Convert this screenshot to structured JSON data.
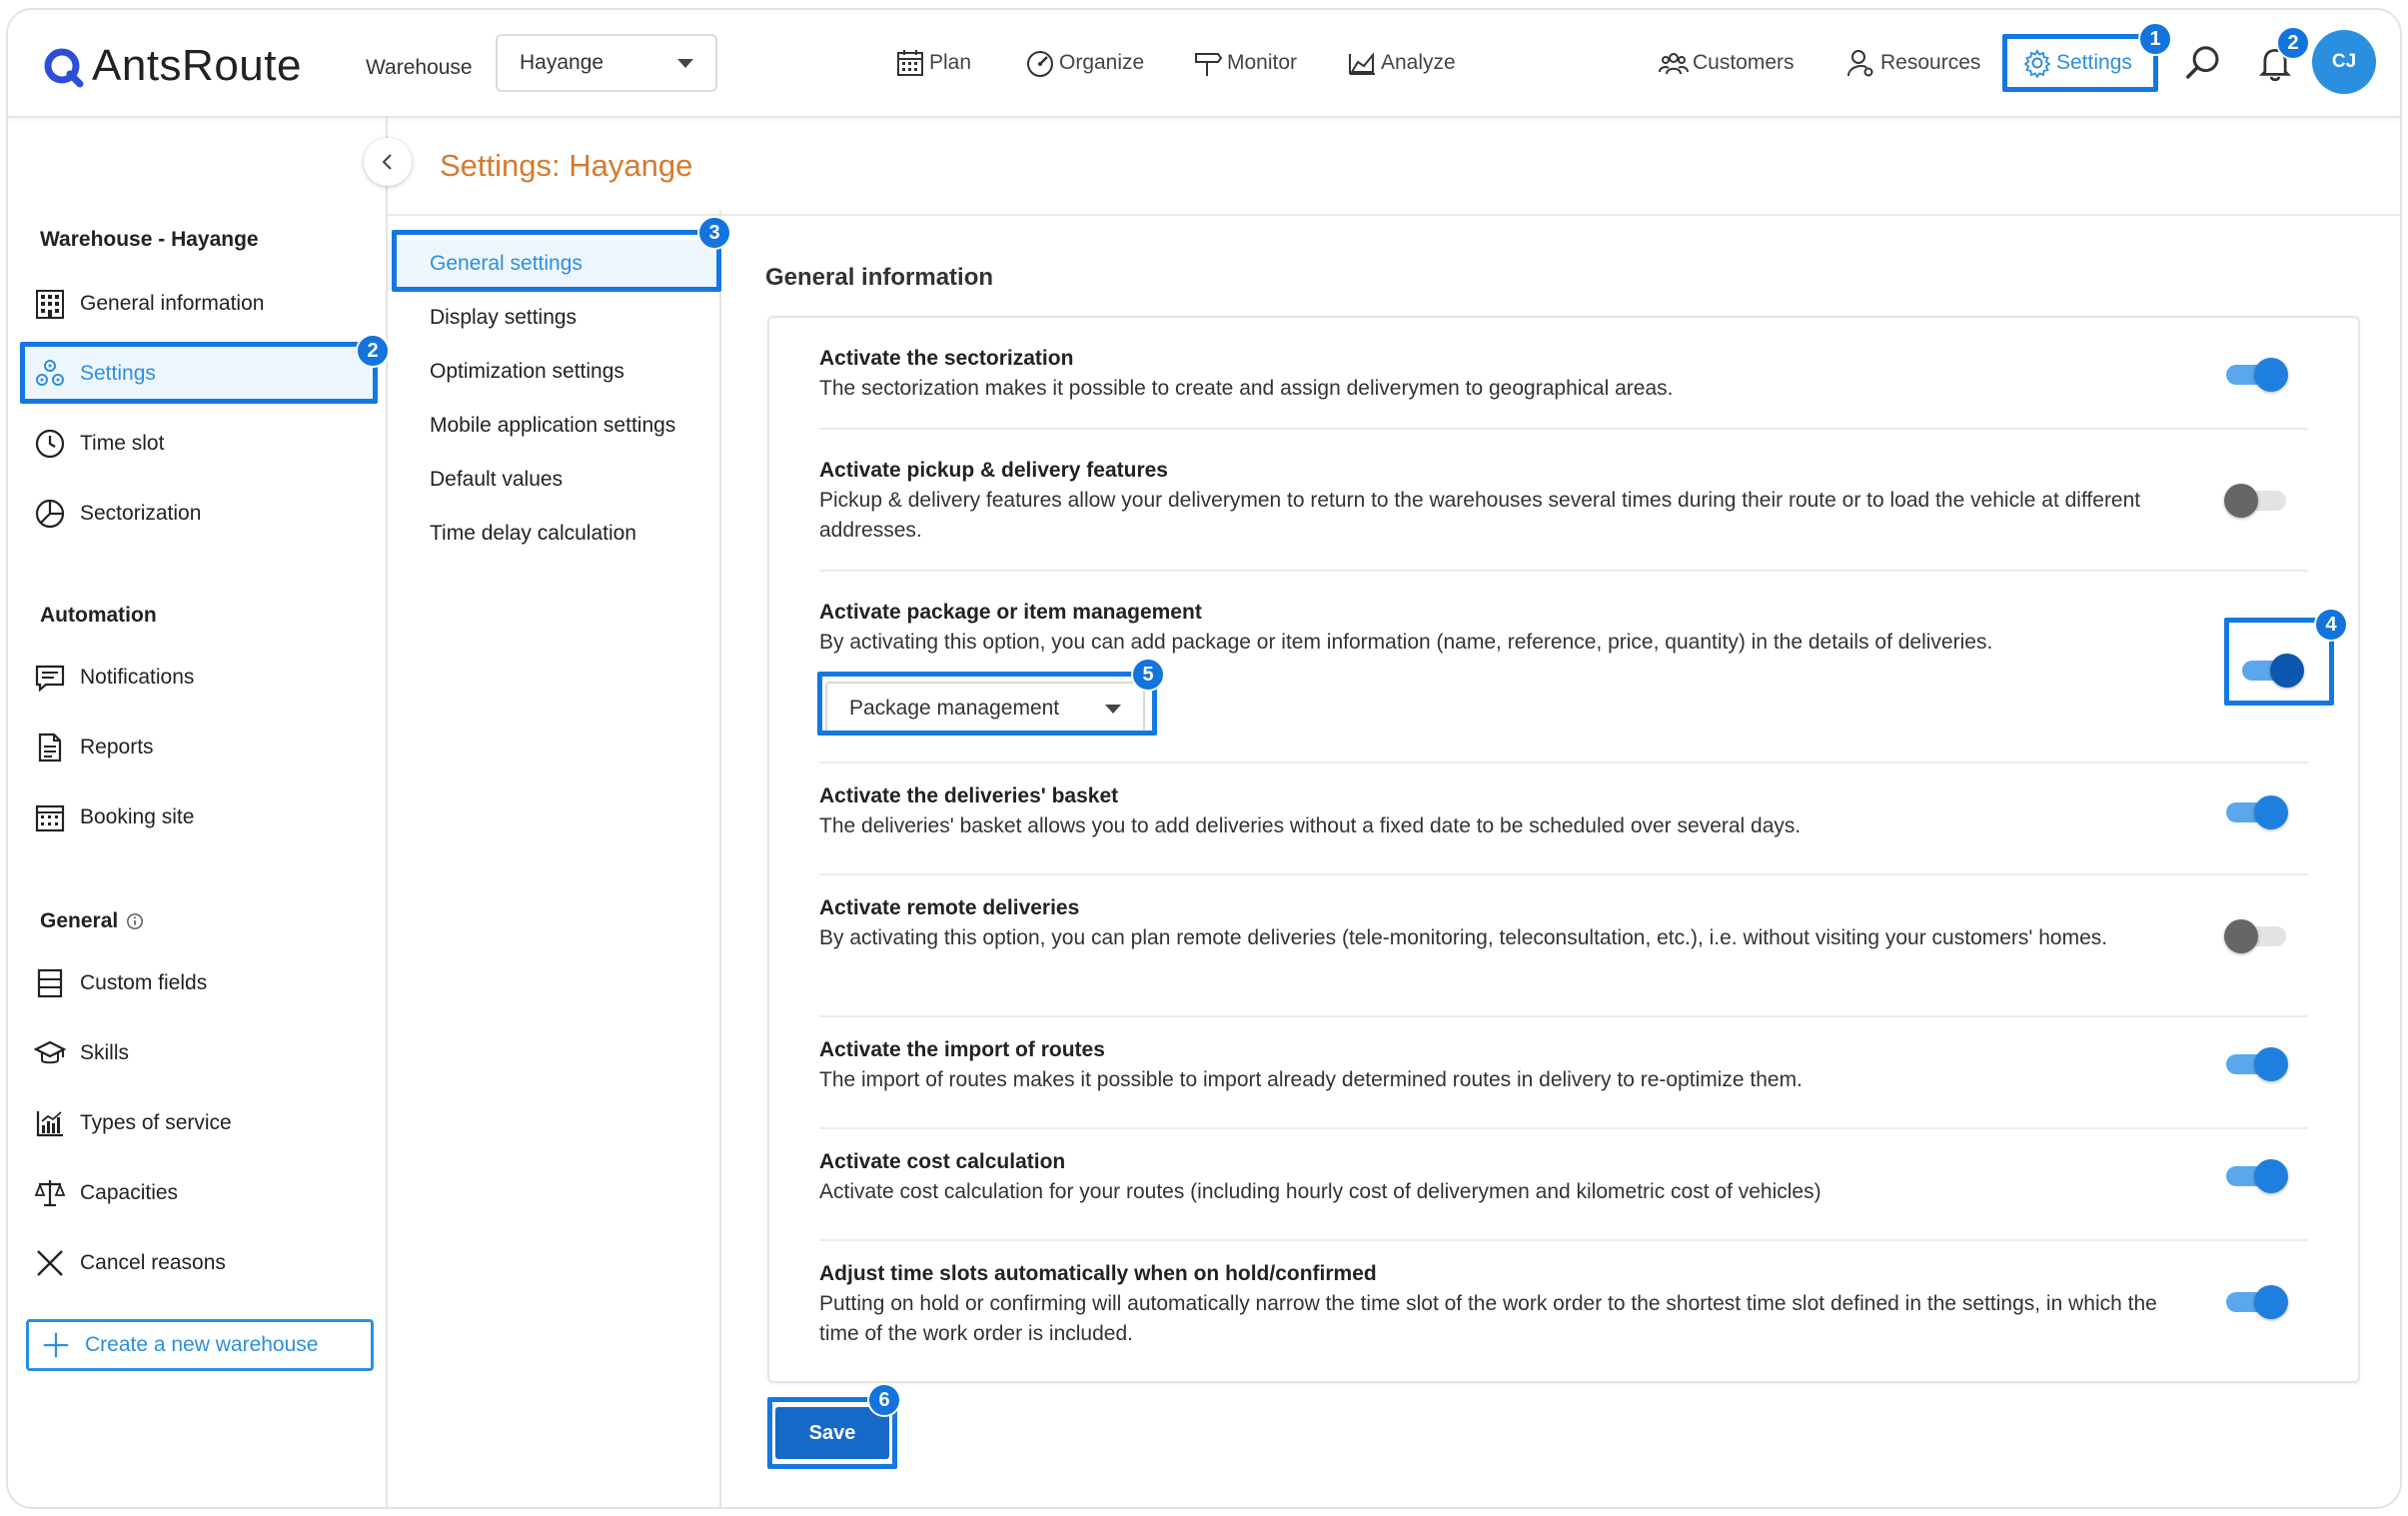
{
  "header": {
    "logo_text": "AntsRoute",
    "warehouse_label": "Warehouse",
    "warehouse_value": "Hayange",
    "nav": {
      "plan": "Plan",
      "organize": "Organize",
      "monitor": "Monitor",
      "analyze": "Analyze",
      "customers": "Customers",
      "resources": "Resources",
      "settings": "Settings"
    },
    "notification_count": "2",
    "avatar_initials": "CJ"
  },
  "page": {
    "title": "Settings: Hayange"
  },
  "sidebar": {
    "warehouse_heading": "Warehouse - Hayange",
    "warehouse_items": [
      {
        "label": "General information",
        "icon": "building-icon"
      },
      {
        "label": "Settings",
        "icon": "cogs-icon"
      },
      {
        "label": "Time slot",
        "icon": "clock-icon"
      },
      {
        "label": "Sectorization",
        "icon": "pie-icon"
      }
    ],
    "automation_heading": "Automation",
    "automation_items": [
      {
        "label": "Notifications",
        "icon": "message-icon"
      },
      {
        "label": "Reports",
        "icon": "document-icon"
      },
      {
        "label": "Booking site",
        "icon": "calendar-icon"
      }
    ],
    "general_heading": "General",
    "general_items": [
      {
        "label": "Custom fields",
        "icon": "list-icon"
      },
      {
        "label": "Skills",
        "icon": "graduation-cap-icon"
      },
      {
        "label": "Types of service",
        "icon": "chart-icon"
      },
      {
        "label": "Capacities",
        "icon": "scale-icon"
      },
      {
        "label": "Cancel reasons",
        "icon": "x-icon"
      }
    ],
    "create_button": "Create a new warehouse"
  },
  "subnav": {
    "items": [
      "General settings",
      "Display settings",
      "Optimization settings",
      "Mobile application settings",
      "Default values",
      "Time delay calculation"
    ]
  },
  "main": {
    "section_title": "General information",
    "settings": [
      {
        "title": "Activate the sectorization",
        "desc": "The sectorization makes it possible to create and assign deliverymen to geographical areas.",
        "enabled": true
      },
      {
        "title": "Activate pickup & delivery features",
        "desc": "Pickup & delivery features allow your deliverymen to return to the warehouses several times during their route or to load the vehicle at different addresses.",
        "enabled": false
      },
      {
        "title": "Activate package or item management",
        "desc": "By activating this option, you can add package or item information (name, reference, price, quantity) in the details of deliveries.",
        "enabled": true,
        "select_value": "Package management"
      },
      {
        "title": "Activate the deliveries' basket",
        "desc": "The deliveries' basket allows you to add deliveries without a fixed date to be scheduled over several days.",
        "enabled": true
      },
      {
        "title": "Activate remote deliveries",
        "desc": "By activating this option, you can plan remote deliveries (tele-monitoring, teleconsultation, etc.), i.e. without visiting your customers' homes.",
        "enabled": false
      },
      {
        "title": "Activate the import of routes",
        "desc": "The import of routes makes it possible to import already determined routes in delivery to re-optimize them.",
        "enabled": true
      },
      {
        "title": "Activate cost calculation",
        "desc": "Activate cost calculation for your routes (including hourly cost of deliverymen and kilometric cost of vehicles)",
        "enabled": true
      },
      {
        "title": "Adjust time slots automatically when on hold/confirmed",
        "desc": "Putting on hold or confirming will automatically narrow the time slot of the work order to the shortest time slot defined in the settings, in which the time of the work order is included.",
        "enabled": true
      }
    ],
    "save_label": "Save"
  },
  "callouts": [
    "1",
    "2",
    "3",
    "4",
    "5",
    "6"
  ],
  "colors": {
    "accent": "#2b8fe0",
    "highlight": "#1478e0",
    "title_orange": "#d67a2e",
    "save": "#1669c7"
  }
}
